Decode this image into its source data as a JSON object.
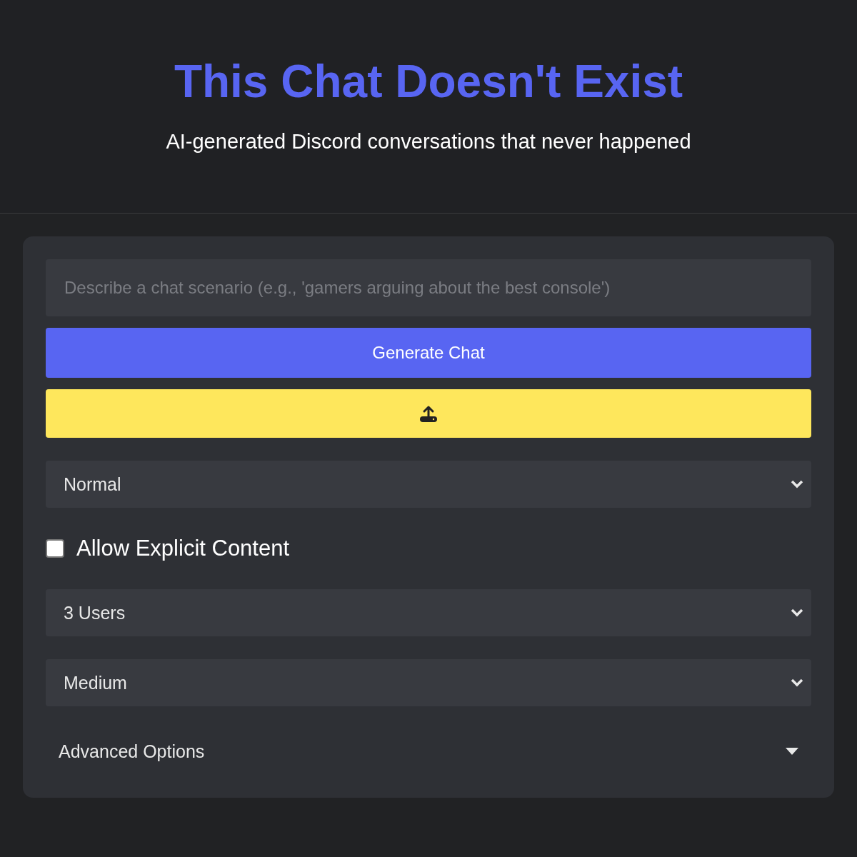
{
  "header": {
    "title": "This Chat Doesn't Exist",
    "subtitle": "AI-generated Discord conversations that never happened"
  },
  "form": {
    "scenario_field": {
      "placeholder": "Describe a chat scenario (e.g., 'gamers arguing about the best console')"
    },
    "generate_button": "Generate Chat",
    "mode_select": {
      "value": "Normal"
    },
    "explicit_checkbox": {
      "label": "Allow Explicit Content",
      "checked": false
    },
    "users_select": {
      "value": "3 Users"
    },
    "length_select": {
      "value": "Medium"
    },
    "advanced_options": {
      "label": "Advanced Options",
      "expanded": false
    }
  }
}
